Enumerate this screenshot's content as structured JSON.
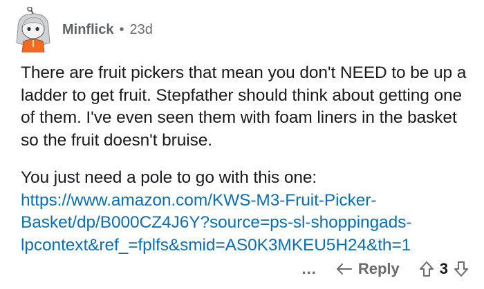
{
  "comment": {
    "author": "Minflick",
    "separator": "•",
    "age": "23d",
    "paragraph1": "There are fruit pickers that mean you don't NEED to be up a ladder to get fruit.  Stepfather should think about getting one of them.  I've even seen them with foam liners in the basket so the fruit doesn't bruise.",
    "paragraph2_text": "You just need a pole to go with this one: ",
    "paragraph2_link": "https://www.amazon.com/KWS-M3-Fruit-Picker-Basket/dp/B000CZ4J6Y?source=ps-sl-shoppingads-lpcontext&ref_=fplfs&smid=AS0K3MKEU5H24&th=1"
  },
  "actions": {
    "more": "...",
    "reply_label": "Reply",
    "score": "3"
  },
  "colors": {
    "link": "#0a6fb8",
    "text": "#1a1a1b",
    "muted": "#6b6b6b",
    "avatar_shirt": "#f26b21",
    "avatar_hair": "#cfd3d6"
  },
  "icons": {
    "avatar": "snoo-avatar",
    "more": "more-icon",
    "reply": "reply-arrow-icon",
    "upvote": "upvote-arrow-icon",
    "downvote": "downvote-arrow-icon"
  }
}
